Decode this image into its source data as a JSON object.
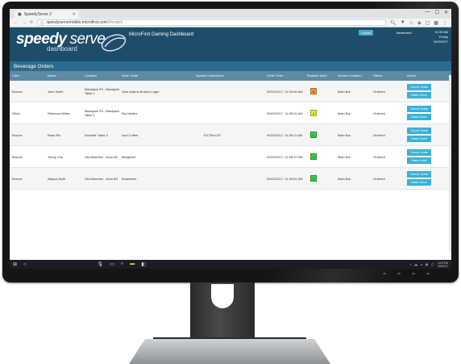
{
  "browser": {
    "tab_title": "SpeedyServe 2",
    "url_host": "speedyservemobile.microfirst.com",
    "url_path": "/#/orders",
    "controls": [
      "—",
      "☐",
      "✕"
    ]
  },
  "header": {
    "logo_word_a": "speedy",
    "logo_word_b": "serve",
    "logo_sub": "dashboard",
    "dashboard_title": "MicroFirst Gaming Dashboard",
    "logout_label": "Logout",
    "user": "bartender1",
    "clock_time": "11:39 AM",
    "clock_day": "Friday",
    "clock_date": "9/22/2017"
  },
  "section": {
    "title": "Beverage Orders"
  },
  "columns": [
    "Card",
    "Name",
    "Location",
    "Drink Order",
    "Special Instructions",
    "Order Time",
    "Elapsed (min)",
    "Service Location",
    "Status",
    "Action"
  ],
  "orders": [
    {
      "card": "Bronze",
      "name": "Jack Smith",
      "location": "Blackjack Pit - Blackjack Table 1",
      "drink": "Sam Adams Boston Lager",
      "instructions": "",
      "time": "09/22/2017, 11:33:44 AM",
      "elapsed": "6",
      "elapsed_color": "#f39c2b",
      "service": "Main Bar",
      "status": "Ordered"
    },
    {
      "card": "Silver",
      "name": "Rebecca Willas",
      "location": "Blackjack Pit - Blackjack Table 1",
      "drink": "Dry Martini",
      "instructions": "",
      "time": "09/22/2017, 11:35:01 AM",
      "elapsed": "4",
      "elapsed_color": "#e8e83a",
      "service": "Main Bar",
      "status": "Ordered"
    },
    {
      "card": "Bronze",
      "name": "Brian Rio",
      "location": "Roulette Table 2",
      "drink": "Iced Coffee",
      "instructions": "EXTRA ICE",
      "time": "09/22/2017, 11:38:11 AM",
      "elapsed": "1",
      "elapsed_color": "#3ad13a",
      "service": "Main Bar",
      "status": "Ordered"
    },
    {
      "card": "Bronze",
      "name": "Jenny Cho",
      "location": "Slot Machine - Area 2B",
      "drink": "Margarita",
      "instructions": "",
      "time": "09/22/2017, 11:38:37 AM",
      "elapsed": "1",
      "elapsed_color": "#3ad13a",
      "service": "Main Bar",
      "status": "Ordered"
    },
    {
      "card": "Bronze",
      "name": "Allyson Bohl",
      "location": "Slot Machine - Area 6D",
      "drink": "Budweiser",
      "instructions": "",
      "time": "09/22/2017, 11:39:51 AM",
      "elapsed": "1",
      "elapsed_color": "#3ad13a",
      "service": "Main Bar",
      "status": "Ordered"
    }
  ],
  "action_labels": {
    "cancel": "Cancel Order",
    "make": "Make Drink"
  },
  "taskbar": {
    "time": "4:23 PM",
    "date": "7/5/2017"
  }
}
